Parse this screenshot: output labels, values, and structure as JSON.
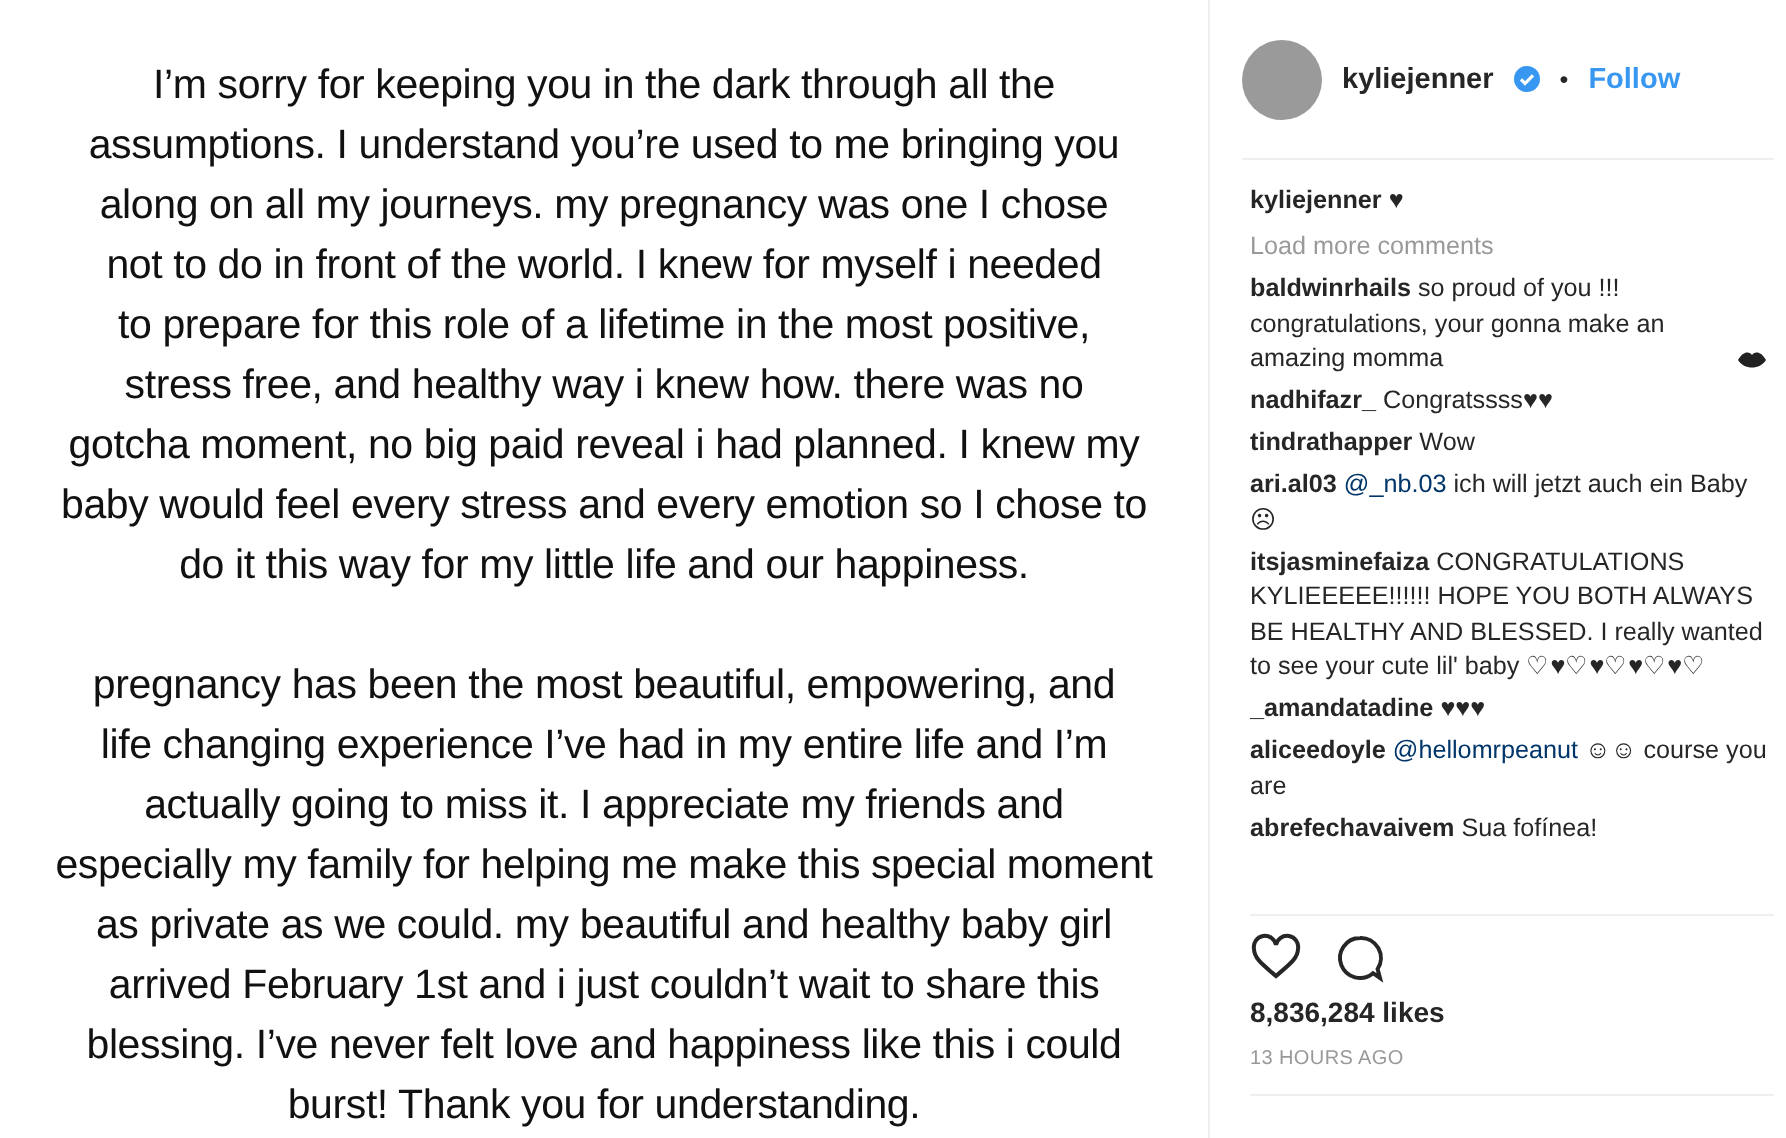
{
  "post_image": {
    "kind": "picture",
    "paragraphs": [
      {
        "lines": [
          "I’m sorry for keeping you in the dark through all the",
          "assumptions. I understand you’re used to me bringing you",
          "along on all my journeys. my pregnancy was one I chose",
          "not to do in front of the world. I knew for myself i needed",
          "to prepare for this role of a lifetime in the most positive,",
          "stress free, and healthy way i knew how. there was no",
          "gotcha moment, no big paid reveal i had planned. I knew my",
          "baby would feel every stress and every emotion so I chose to",
          "do it this way for my little life and our happiness."
        ]
      },
      {
        "lines": [
          "pregnancy has been the most beautiful, empowering, and",
          "life changing experience I’ve had in my entire life and I’m",
          "actually going to miss it. I appreciate my friends and",
          "especially my family for helping me make this special moment",
          "as private as we could. my beautiful and healthy baby girl",
          "arrived February 1st and i just couldn’t wait to share this",
          "blessing. I’ve never felt love and happiness like this i could",
          "burst! Thank you for understanding."
        ]
      }
    ]
  },
  "header": {
    "username": "kyliejenner",
    "verified": true,
    "separator": "•",
    "follow": "Follow"
  },
  "caption": {
    "user": "kyliejenner",
    "parts": [
      {
        "kind": "text",
        "text": "♥"
      }
    ]
  },
  "load_more": "Load more comments",
  "comments": [
    {
      "user": "baldwinrhails",
      "parts": [
        {
          "kind": "text",
          "text": "so proud of you !!! congratulations, your gonna make an amazing momma"
        },
        {
          "kind": "lips"
        }
      ]
    },
    {
      "user": "nadhifazr_",
      "parts": [
        {
          "kind": "text",
          "text": "Congratssss♥♥"
        }
      ]
    },
    {
      "user": "tindrathapper",
      "parts": [
        {
          "kind": "text",
          "text": "Wow"
        }
      ]
    },
    {
      "user": "ari.al03",
      "parts": [
        {
          "kind": "mention",
          "text": "@_nb.03"
        },
        {
          "kind": "text",
          "text": "ich will jetzt auch ein Baby ☹"
        }
      ]
    },
    {
      "user": "itsjasminefaiza",
      "parts": [
        {
          "kind": "text",
          "text": "CONGRATULATIONS KYLIEEEEE!!!!!! HOPE YOU BOTH ALWAYS BE HEALTHY AND BLESSED. I really wanted to see your cute lil' baby ♡♥♡♥♡♥♡♥♡"
        }
      ]
    },
    {
      "user": "_amandatadine",
      "parts": [
        {
          "kind": "text",
          "text": "♥♥♥"
        }
      ]
    },
    {
      "user": "aliceedoyle",
      "parts": [
        {
          "kind": "mention",
          "text": "@hellomrpeanut"
        },
        {
          "kind": "text",
          "text": "☺☺ course you are"
        }
      ]
    },
    {
      "user": "abrefechavaivem",
      "parts": [
        {
          "kind": "text",
          "text": "Sua fofínea!"
        }
      ]
    }
  ],
  "likes": "8,836,284 likes",
  "time": "13 HOURS AGO"
}
